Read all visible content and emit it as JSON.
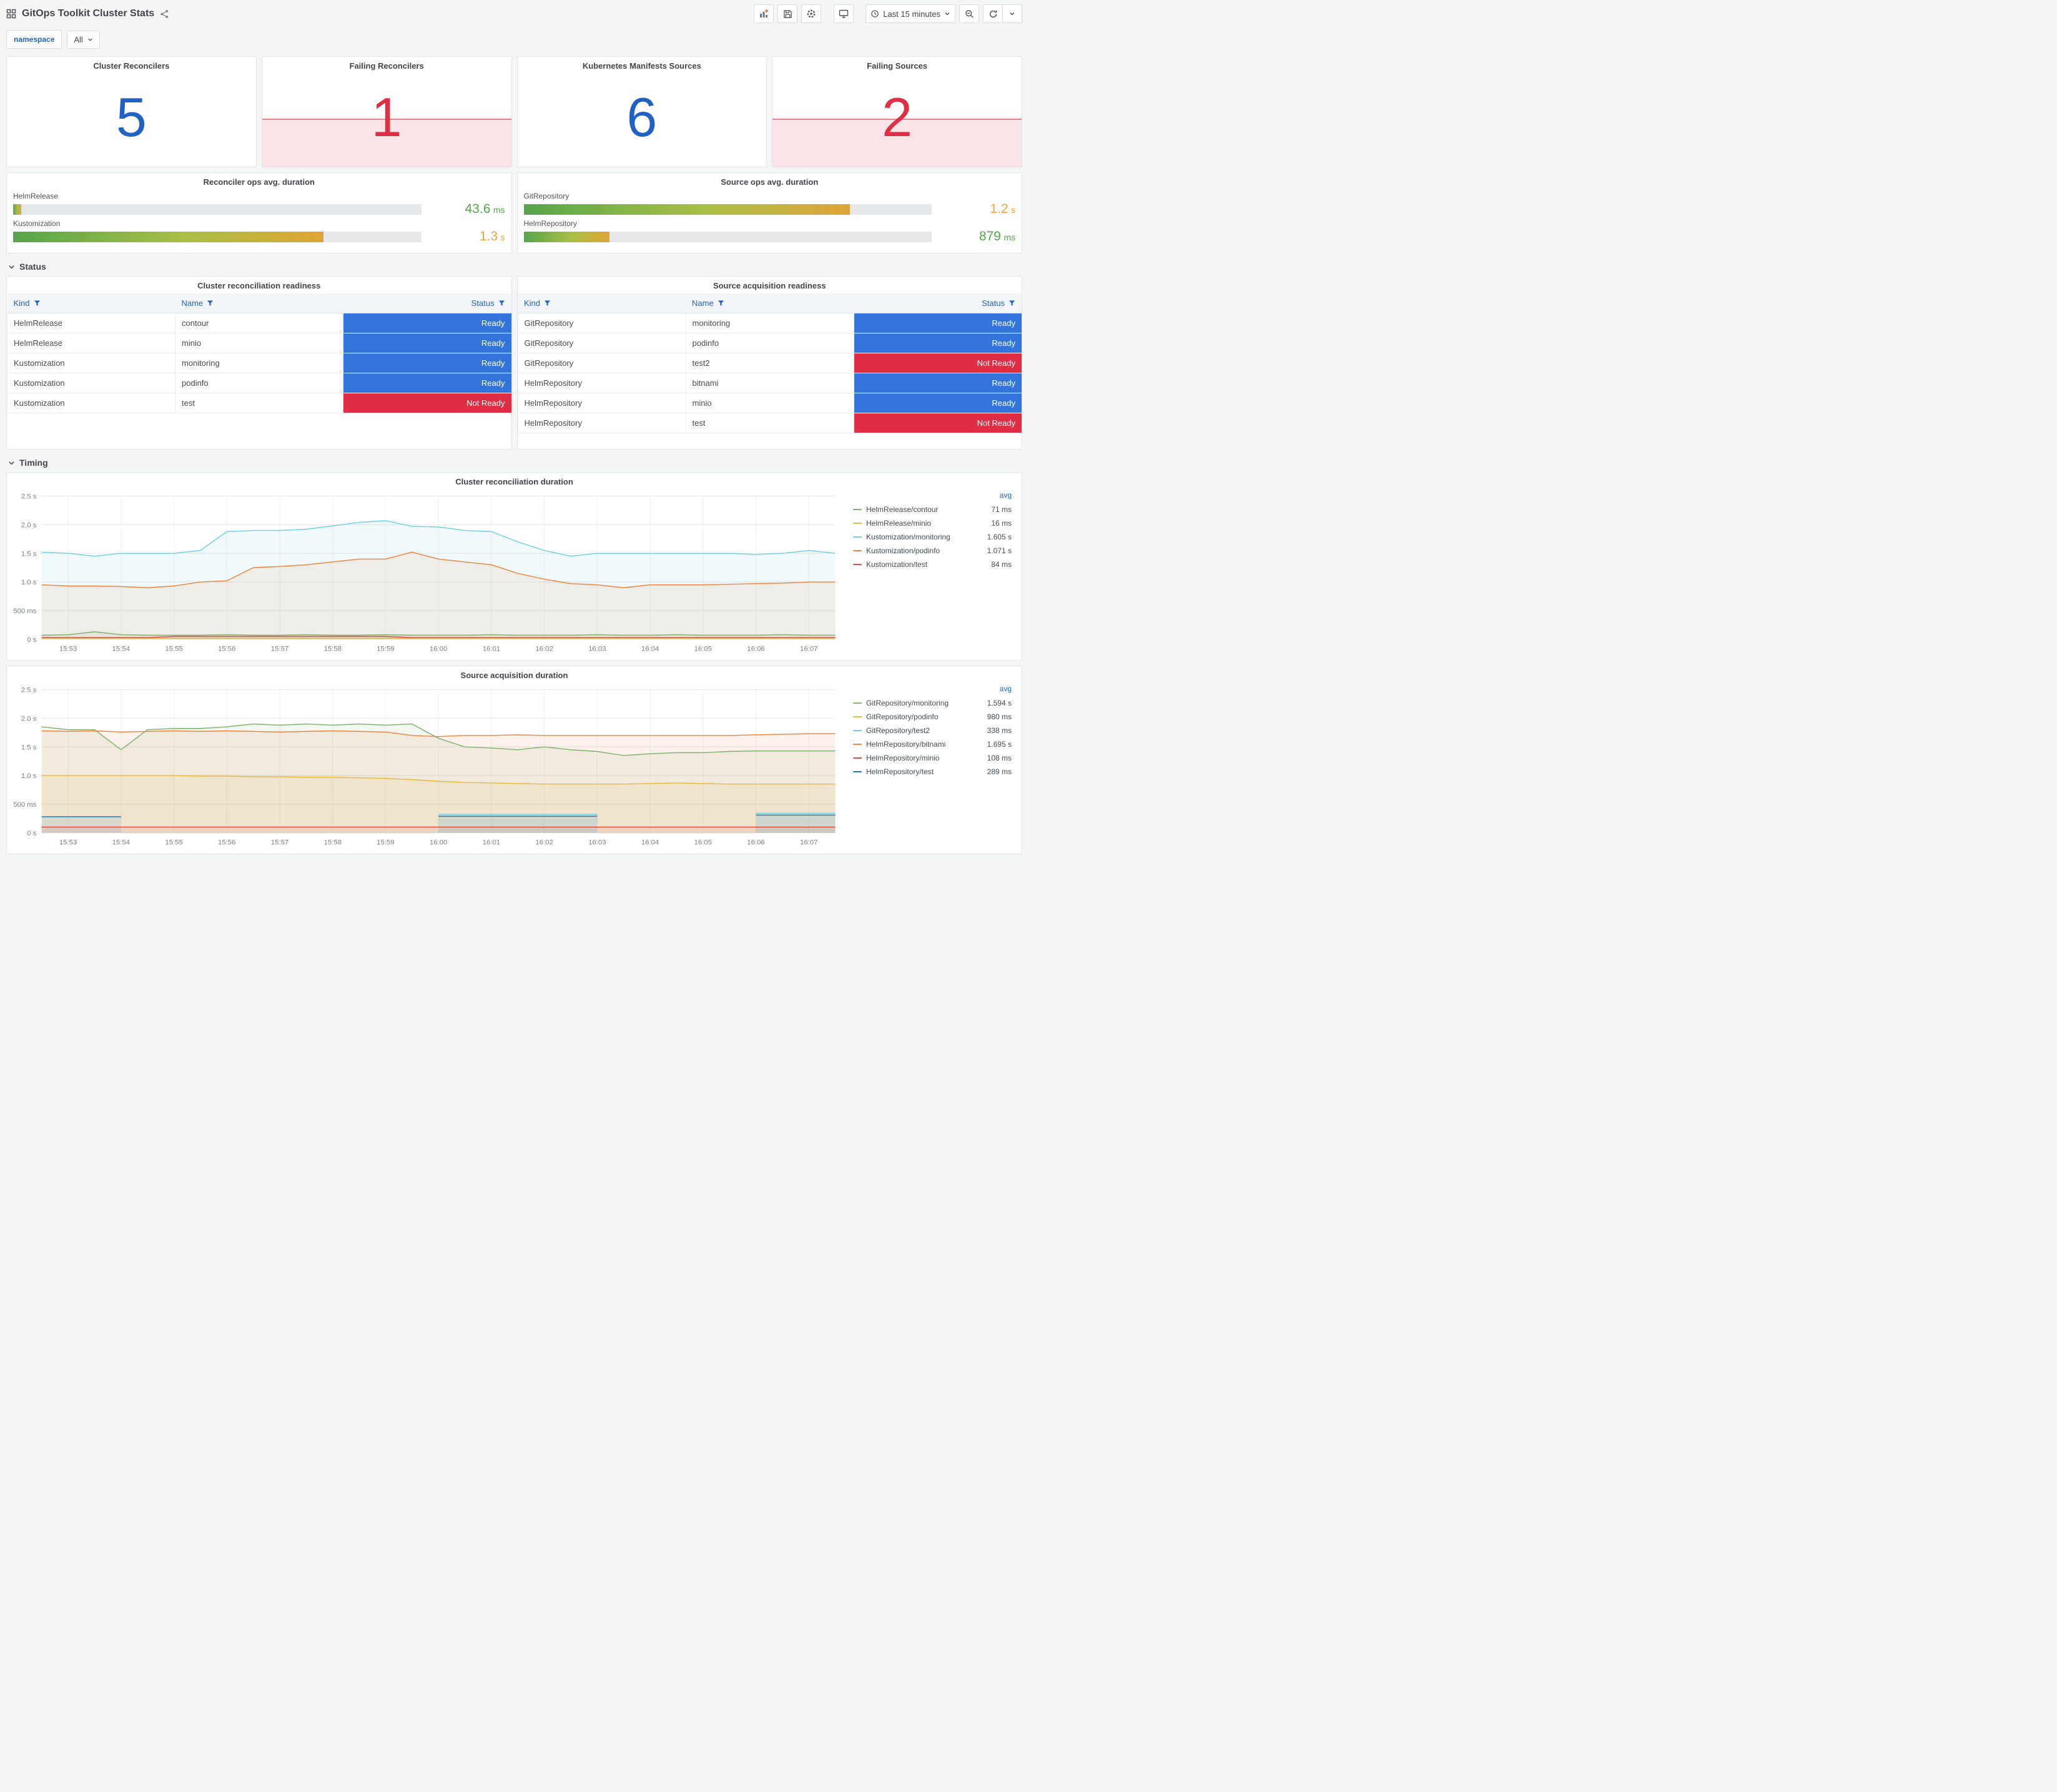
{
  "palette": {
    "accent_blue": "#1f62c4",
    "alert_red": "#e02f44",
    "status_ready": "#3274d9",
    "status_not_ready": "#e02f44",
    "value_green": "#56a64b",
    "value_orange": "#f2a33c"
  },
  "header": {
    "title": "GitOps Toolkit Cluster Stats",
    "time_range_label": "Last 15 minutes"
  },
  "variables": {
    "label": "namespace",
    "value": "All"
  },
  "section_rows": {
    "status": "Status",
    "timing": "Timing"
  },
  "stats": [
    {
      "title": "Cluster Reconcilers",
      "value": "5",
      "color": "#1f62c4",
      "alert": false
    },
    {
      "title": "Failing Reconcilers",
      "value": "1",
      "color": "#e02f44",
      "alert": true
    },
    {
      "title": "Kubernetes Manifests Sources",
      "value": "6",
      "color": "#1f62c4",
      "alert": false
    },
    {
      "title": "Failing Sources",
      "value": "2",
      "color": "#e02f44",
      "alert": true
    }
  ],
  "gauges": [
    {
      "title": "Reconciler ops avg. duration",
      "rows": [
        {
          "label": "HelmRelease",
          "value": "43.6",
          "unit": "ms",
          "percent": 2,
          "value_color": "#56a64b"
        },
        {
          "label": "Kustomization",
          "value": "1.3",
          "unit": "s",
          "percent": 76,
          "value_color": "#f2a33c"
        }
      ]
    },
    {
      "title": "Source ops avg. duration",
      "rows": [
        {
          "label": "GitRepository",
          "value": "1.2",
          "unit": "s",
          "percent": 80,
          "value_color": "#f2a33c"
        },
        {
          "label": "HelmRepository",
          "value": "879",
          "unit": "ms",
          "percent": 21,
          "value_color": "#56a64b"
        }
      ]
    }
  ],
  "tables": [
    {
      "title": "Cluster reconciliation readiness",
      "columns": [
        "Kind",
        "Name",
        "Status"
      ],
      "rows": [
        {
          "kind": "HelmRelease",
          "name": "contour",
          "status": "Ready",
          "ready": true
        },
        {
          "kind": "HelmRelease",
          "name": "minio",
          "status": "Ready",
          "ready": true
        },
        {
          "kind": "Kustomization",
          "name": "monitoring",
          "status": "Ready",
          "ready": true
        },
        {
          "kind": "Kustomization",
          "name": "podinfo",
          "status": "Ready",
          "ready": true
        },
        {
          "kind": "Kustomization",
          "name": "test",
          "status": "Not Ready",
          "ready": false
        }
      ]
    },
    {
      "title": "Source acquisition readiness",
      "columns": [
        "Kind",
        "Name",
        "Status"
      ],
      "rows": [
        {
          "kind": "GitRepository",
          "name": "monitoring",
          "status": "Ready",
          "ready": true
        },
        {
          "kind": "GitRepository",
          "name": "podinfo",
          "status": "Ready",
          "ready": true
        },
        {
          "kind": "GitRepository",
          "name": "test2",
          "status": "Not Ready",
          "ready": false
        },
        {
          "kind": "HelmRepository",
          "name": "bitnami",
          "status": "Ready",
          "ready": true
        },
        {
          "kind": "HelmRepository",
          "name": "minio",
          "status": "Ready",
          "ready": true
        },
        {
          "kind": "HelmRepository",
          "name": "test",
          "status": "Not Ready",
          "ready": false
        }
      ]
    }
  ],
  "chart_data": [
    {
      "type": "line",
      "title": "Cluster reconciliation duration",
      "legend_header": "avg",
      "legend_position": "right",
      "grid": true,
      "ylim": [
        0,
        2.5
      ],
      "yticks": [
        {
          "v": 0,
          "label": "0 s"
        },
        {
          "v": 0.5,
          "label": "500 ms"
        },
        {
          "v": 1,
          "label": "1.0 s"
        },
        {
          "v": 1.5,
          "label": "1.5 s"
        },
        {
          "v": 2,
          "label": "2.0 s"
        },
        {
          "v": 2.5,
          "label": "2.5 s"
        }
      ],
      "x_labels": [
        "15:53",
        "15:54",
        "15:55",
        "15:56",
        "15:57",
        "15:58",
        "15:59",
        "16:00",
        "16:01",
        "16:02",
        "16:03",
        "16:04",
        "16:05",
        "16:06",
        "16:07"
      ],
      "series": [
        {
          "name": "HelmRelease/contour",
          "color": "#7EB26D",
          "avg": "71 ms",
          "points": [
            0.07,
            0.08,
            0.13,
            0.08,
            0.07,
            0.07,
            0.07,
            0.08,
            0.07,
            0.07,
            0.08,
            0.07,
            0.07,
            0.08,
            0.07,
            0.07,
            0.07,
            0.08,
            0.07,
            0.07,
            0.07,
            0.08,
            0.07,
            0.07,
            0.08,
            0.07,
            0.07,
            0.07,
            0.08,
            0.07,
            0.07
          ]
        },
        {
          "name": "HelmRelease/minio",
          "color": "#EAB839",
          "avg": "16 ms",
          "points": [
            0.02,
            0.02,
            0.02,
            0.02,
            0.02,
            0.02,
            0.02,
            0.02,
            0.02,
            0.02,
            0.02,
            0.02,
            0.02,
            0.02,
            0.02,
            0.02,
            0.02,
            0.02,
            0.02,
            0.02,
            0.02,
            0.02,
            0.02,
            0.02,
            0.02,
            0.02,
            0.02,
            0.02,
            0.02,
            0.02,
            0.02
          ]
        },
        {
          "name": "Kustomization/monitoring",
          "color": "#6ED0E0",
          "avg": "1.605 s",
          "points": [
            1.52,
            1.5,
            1.45,
            1.5,
            1.5,
            1.5,
            1.55,
            1.88,
            1.9,
            1.9,
            1.92,
            1.98,
            2.04,
            2.07,
            1.97,
            1.96,
            1.9,
            1.88,
            1.7,
            1.55,
            1.45,
            1.5,
            1.5,
            1.5,
            1.5,
            1.5,
            1.5,
            1.48,
            1.5,
            1.55,
            1.5
          ]
        },
        {
          "name": "Kustomization/podinfo",
          "color": "#EF843C",
          "avg": "1.071 s",
          "points": [
            0.95,
            0.93,
            0.93,
            0.92,
            0.9,
            0.93,
            1.0,
            1.02,
            1.25,
            1.27,
            1.3,
            1.35,
            1.4,
            1.4,
            1.52,
            1.4,
            1.35,
            1.3,
            1.15,
            1.05,
            0.97,
            0.95,
            0.9,
            0.95,
            0.95,
            0.95,
            0.96,
            0.97,
            0.98,
            1.0,
            1.0
          ]
        },
        {
          "name": "Kustomization/test",
          "color": "#E24D42",
          "avg": "84 ms",
          "points": [
            0.03,
            0.03,
            0.03,
            0.03,
            0.03,
            0.05,
            0.05,
            0.05,
            0.05,
            0.05,
            0.05,
            0.05,
            0.05,
            0.05,
            0.03,
            0.03,
            0.03,
            0.03,
            0.03,
            0.03,
            0.03,
            0.03,
            0.03,
            0.03,
            0.03,
            0.03,
            0.03,
            0.03,
            0.03,
            0.03,
            0.03
          ]
        }
      ]
    },
    {
      "type": "line",
      "title": "Source acquisition duration",
      "legend_header": "avg",
      "legend_position": "right",
      "grid": true,
      "ylim": [
        0,
        2.5
      ],
      "yticks": [
        {
          "v": 0,
          "label": "0 s"
        },
        {
          "v": 0.5,
          "label": "500 ms"
        },
        {
          "v": 1,
          "label": "1.0 s"
        },
        {
          "v": 1.5,
          "label": "1.5 s"
        },
        {
          "v": 2,
          "label": "2.0 s"
        },
        {
          "v": 2.5,
          "label": "2.5 s"
        }
      ],
      "x_labels": [
        "15:53",
        "15:54",
        "15:55",
        "15:56",
        "15:57",
        "15:58",
        "15:59",
        "16:00",
        "16:01",
        "16:02",
        "16:03",
        "16:04",
        "16:05",
        "16:06",
        "16:07"
      ],
      "series": [
        {
          "name": "GitRepository/monitoring",
          "color": "#7EB26D",
          "avg": "1.594 s",
          "points": [
            1.85,
            1.8,
            1.8,
            1.45,
            1.8,
            1.82,
            1.82,
            1.85,
            1.9,
            1.88,
            1.9,
            1.88,
            1.9,
            1.88,
            1.9,
            1.65,
            1.5,
            1.48,
            1.45,
            1.5,
            1.45,
            1.42,
            1.35,
            1.38,
            1.4,
            1.4,
            1.42,
            1.43,
            1.43,
            1.43,
            1.43
          ]
        },
        {
          "name": "GitRepository/podinfo",
          "color": "#EAB839",
          "avg": "980 ms",
          "points": [
            1.0,
            1.0,
            1.0,
            1.0,
            1.0,
            1.0,
            0.99,
            0.99,
            0.98,
            0.98,
            0.97,
            0.97,
            0.96,
            0.95,
            0.93,
            0.9,
            0.88,
            0.87,
            0.86,
            0.85,
            0.85,
            0.85,
            0.85,
            0.86,
            0.87,
            0.86,
            0.85,
            0.85,
            0.85,
            0.85,
            0.85
          ]
        },
        {
          "name": "GitRepository/test2",
          "color": "#6ED0E0",
          "avg": "338 ms",
          "points": [
            null,
            null,
            null,
            null,
            null,
            null,
            null,
            null,
            null,
            null,
            null,
            null,
            null,
            null,
            null,
            0.32,
            0.32,
            0.32,
            0.32,
            0.32,
            0.32,
            0.32,
            null,
            null,
            null,
            null,
            null,
            0.34,
            0.34,
            0.34,
            0.34
          ]
        },
        {
          "name": "HelmRepository/bitnami",
          "color": "#EF843C",
          "avg": "1.695 s",
          "points": [
            1.78,
            1.77,
            1.78,
            1.76,
            1.77,
            1.78,
            1.77,
            1.78,
            1.77,
            1.76,
            1.77,
            1.78,
            1.77,
            1.76,
            1.7,
            1.68,
            1.7,
            1.7,
            1.71,
            1.7,
            1.7,
            1.7,
            1.7,
            1.7,
            1.7,
            1.7,
            1.7,
            1.71,
            1.72,
            1.73,
            1.73
          ]
        },
        {
          "name": "HelmRepository/minio",
          "color": "#E24D42",
          "avg": "108 ms",
          "points": [
            0.1,
            0.1,
            0.1,
            0.1,
            0.1,
            0.1,
            0.1,
            0.1,
            0.1,
            0.1,
            0.1,
            0.1,
            0.1,
            0.1,
            0.1,
            0.1,
            0.1,
            0.1,
            0.1,
            0.1,
            0.1,
            0.1,
            0.1,
            0.1,
            0.1,
            0.1,
            0.1,
            0.1,
            0.1,
            0.1,
            0.1
          ]
        },
        {
          "name": "HelmRepository/test",
          "color": "#1F78C1",
          "avg": "289 ms",
          "points": [
            0.28,
            0.28,
            0.28,
            0.28,
            null,
            null,
            null,
            null,
            null,
            null,
            null,
            null,
            null,
            null,
            null,
            0.29,
            0.29,
            0.29,
            0.29,
            0.29,
            0.29,
            0.29,
            null,
            null,
            null,
            null,
            null,
            0.31,
            0.31,
            0.31,
            0.31
          ]
        }
      ]
    }
  ]
}
